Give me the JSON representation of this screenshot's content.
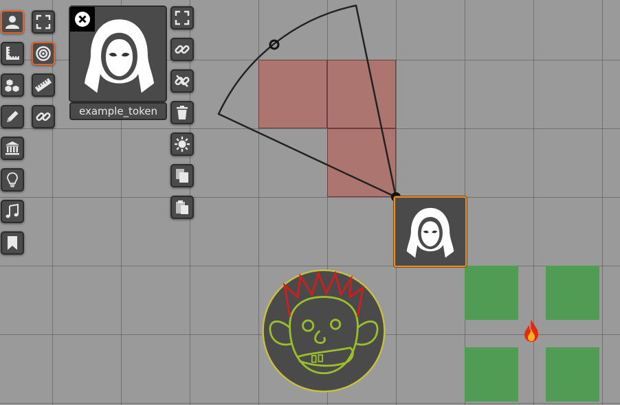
{
  "token": {
    "name": "example_token"
  },
  "toolbar": {
    "left_column": [
      {
        "name": "token-tool",
        "icon": "user-icon",
        "active": true
      },
      {
        "name": "measure-tool",
        "icon": "ruler-angle-icon",
        "active": false
      },
      {
        "name": "shapes-tool",
        "icon": "cubes-icon",
        "active": false
      },
      {
        "name": "draw-tool",
        "icon": "pencil-icon",
        "active": false
      },
      {
        "name": "buildings-tool",
        "icon": "bank-icon",
        "active": false
      },
      {
        "name": "light-tool",
        "icon": "lightbulb-icon",
        "active": false
      },
      {
        "name": "music-tool",
        "icon": "music-note-icon",
        "active": false
      },
      {
        "name": "bookmark-tool",
        "icon": "bookmark-icon",
        "active": false
      }
    ],
    "second_column": [
      {
        "name": "fullscreen",
        "icon": "expand-icon",
        "active": false
      },
      {
        "name": "target",
        "icon": "target-icon",
        "active": true
      },
      {
        "name": "ruler",
        "icon": "ruler-icon",
        "active": false
      },
      {
        "name": "link",
        "icon": "link-icon",
        "active": false
      }
    ],
    "token_actions": [
      {
        "name": "expand",
        "icon": "expand-icon"
      },
      {
        "name": "link",
        "icon": "link-icon"
      },
      {
        "name": "unlink",
        "icon": "unlink-icon"
      },
      {
        "name": "delete",
        "icon": "trash-icon"
      },
      {
        "name": "settings",
        "icon": "sun-gear-icon"
      },
      {
        "name": "copy",
        "icon": "copy-icon"
      },
      {
        "name": "paste",
        "icon": "paste-icon"
      }
    ]
  },
  "colors": {
    "map_background": "#9a9a9a",
    "button_bg": "#4b4b4b",
    "active_border": "#e2622a",
    "selection_border": "#e8902a",
    "fog_red": "#b06e69",
    "green_area": "#519c55",
    "npc_outline": "#9bbf2a",
    "npc_hair": "#d01d1d"
  }
}
